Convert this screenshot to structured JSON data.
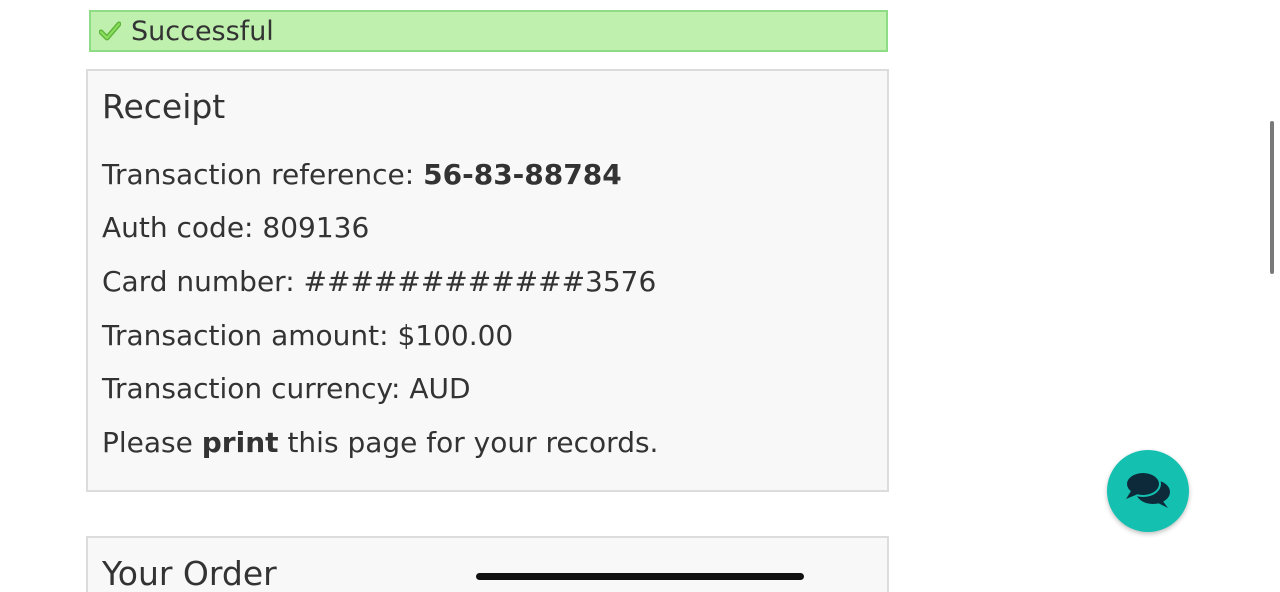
{
  "status": {
    "text": "Successful",
    "icon": "checkmark-icon",
    "background": "#bff0ae"
  },
  "receipt": {
    "title": "Receipt",
    "reference_label": "Transaction reference: ",
    "reference_value": "56-83-88784",
    "auth_code": "Auth code: 809136",
    "card_number": "Card number: ############3576",
    "amount": "Transaction amount: $100.00",
    "currency": "Transaction currency: AUD",
    "print_prefix": "Please ",
    "print_bold": "print",
    "print_suffix": " this page for your records."
  },
  "order": {
    "title": "Your Order"
  },
  "chat": {
    "icon": "chat-bubbles-icon",
    "color": "#14c1b1"
  }
}
